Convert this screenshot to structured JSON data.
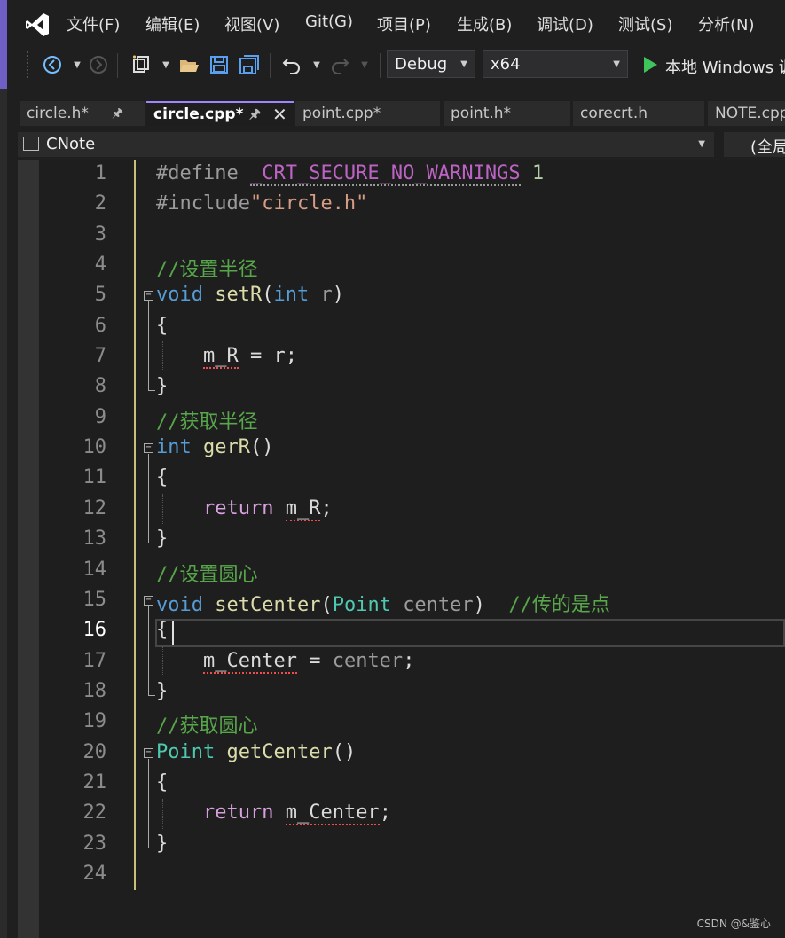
{
  "menu": {
    "items": [
      "文件(F)",
      "编辑(E)",
      "视图(V)",
      "Git(G)",
      "项目(P)",
      "生成(B)",
      "调试(D)",
      "测试(S)",
      "分析(N)"
    ]
  },
  "toolbar": {
    "config": "Debug",
    "platform": "x64",
    "run_label": "本地 Windows 调"
  },
  "tabs": [
    {
      "label": "circle.h*",
      "active": false,
      "pinned": true
    },
    {
      "label": "circle.cpp*",
      "active": true,
      "pinned": true
    },
    {
      "label": "point.cpp*",
      "active": false,
      "pinned": false
    },
    {
      "label": "point.h*",
      "active": false,
      "pinned": false
    },
    {
      "label": "corecrt.h",
      "active": false,
      "pinned": false
    },
    {
      "label": "NOTE.cpp",
      "active": false,
      "pinned": false
    }
  ],
  "nav": {
    "project": "CNote",
    "scope": "(全局"
  },
  "editor": {
    "line_numbers": [
      "1",
      "2",
      "3",
      "4",
      "5",
      "6",
      "7",
      "8",
      "9",
      "10",
      "11",
      "12",
      "13",
      "14",
      "15",
      "16",
      "17",
      "18",
      "19",
      "20",
      "21",
      "22",
      "23",
      "24"
    ],
    "current_line": "16",
    "lines": {
      "l1_directive": "#define",
      "l1_macro": "_CRT_SECURE_NO_WARNINGS",
      "l1_value": "1",
      "l2_directive": "#include",
      "l2_file": "\"circle.h\"",
      "l4_comment": "//设置半径",
      "l5_void": "void",
      "l5_name": "setR",
      "l5_paren_open": "(",
      "l5_int": "int",
      "l5_param": "r",
      "l5_paren_close": ")",
      "l6": "{",
      "l7_member": "m_R",
      "l7_rest": " = r;",
      "l8": "}",
      "l9_comment": "//获取半径",
      "l10_int": "int",
      "l10_name": "gerR",
      "l10_parens": "()",
      "l11": "{",
      "l12_return": "return",
      "l12_member": "m_R",
      "l12_semi": ";",
      "l13": "}",
      "l14_comment": "//设置圆心",
      "l15_void": "void",
      "l15_name": "setCenter",
      "l15_paren_open": "(",
      "l15_type": "Point",
      "l15_param": "center",
      "l15_paren_close": ")",
      "l15_comment": "//传的是点",
      "l16": "{",
      "l17_member": "m_Center",
      "l17_eq": " = ",
      "l17_param": "center",
      "l17_semi": ";",
      "l18": "}",
      "l19_comment": "//获取圆心",
      "l20_type": "Point",
      "l20_name": "getCenter",
      "l20_parens": "()",
      "l21": "{",
      "l22_return": "return",
      "l22_member": "m_Center",
      "l22_semi": ";",
      "l23": "}"
    }
  },
  "watermark": "CSDN @&鉴心",
  "colors": {
    "keyword": "#569cd6",
    "comment": "#57a64a",
    "function": "#dcdcaa",
    "type": "#4ec9b0",
    "control": "#d8a0df",
    "string": "#d69d85",
    "accent": "#9f86ff"
  }
}
